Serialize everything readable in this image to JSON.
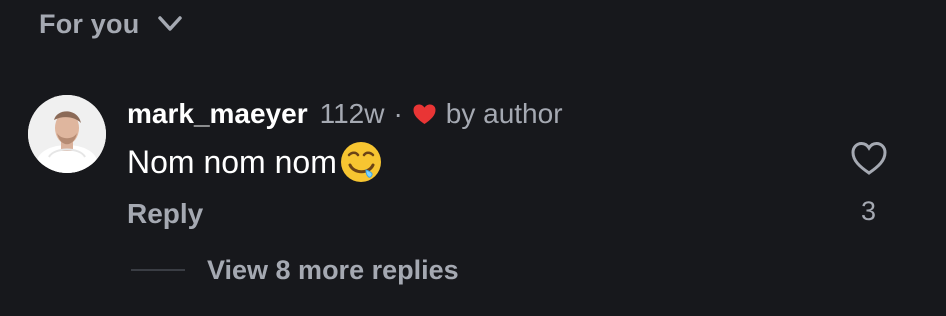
{
  "filter": {
    "label": "For you",
    "icon": "chevron-down-icon"
  },
  "comment": {
    "username": "mark_maeyer",
    "timestamp": "112w",
    "separator": "·",
    "author_like_icon": "heart-icon",
    "author_like_color": "#e93535",
    "author_like_text": "by author",
    "text": "Nom nom nom",
    "emoji": "drooling-face-emoji",
    "reply_label": "Reply",
    "like_icon": "heart-outline-icon",
    "like_count": "3",
    "view_replies_label": "View 8 more replies"
  },
  "colors": {
    "background": "#17181c",
    "primary_text": "#ffffff",
    "secondary_text": "#a5a9b2"
  }
}
